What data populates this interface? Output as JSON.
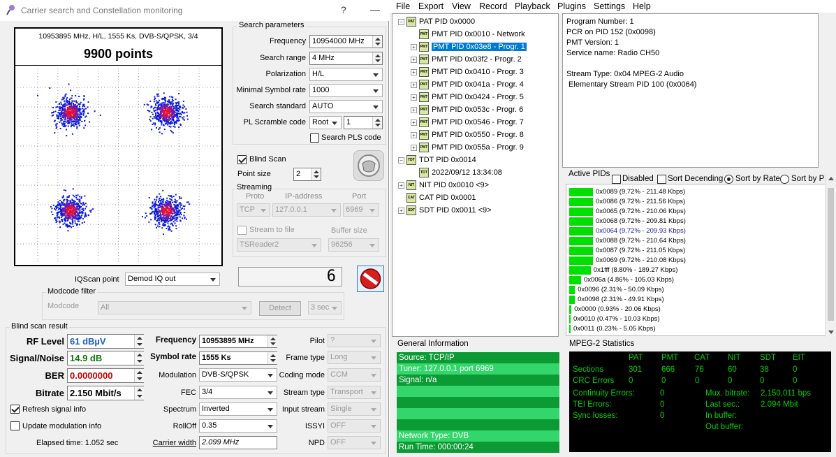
{
  "left_window": {
    "title": "Carrier search and Constellation monitoring",
    "help_btn": "?",
    "minimize_btn": "—",
    "constellation": {
      "info": "10953895 MHz, H/L, 1555 Ks, DVB-S/QPSK, 3/4",
      "points": "9900 points"
    },
    "search_params": {
      "group_title": "Search parameters",
      "frequency_label": "Frequency",
      "frequency": "10954000 MHz",
      "range_label": "Search range",
      "range": "4 MHz",
      "polarization_label": "Polarization",
      "polarization": "H/L",
      "min_sr_label": "Minimal Symbol rate",
      "min_sr": "1000",
      "standard_label": "Search standard",
      "standard": "AUTO",
      "pls_label": "PL Scramble code",
      "pls_mode": "Root",
      "pls_value": "1",
      "search_pls_label": "Search PLS code"
    },
    "blind_scan_label": "Blind Scan",
    "point_size_label": "Point size",
    "point_size": "2",
    "streaming": {
      "group_title": "Streaming",
      "proto_label": "Proto",
      "ip_label": "IP-address",
      "port_label": "Port",
      "proto": "TCP",
      "ip": "127.0.0.1",
      "port": "6969",
      "stream_to_file": "Stream to file",
      "buffer_label": "Buffer size",
      "target": "TSReader2",
      "buffer": "96256"
    },
    "iq_label": "IQScan point",
    "iq_value": "Demod IQ out",
    "counter": "6",
    "modcode": {
      "group_title": "Modcode filter",
      "label": "Modcode",
      "value": "All",
      "detect": "Detect",
      "time": "3 sec"
    },
    "result": {
      "group_title": "Blind scan result",
      "rf_label": "RF Level",
      "rf": "61 dBµV",
      "sn_label": "Signal/Noise",
      "sn": "14.9 dB",
      "ber_label": "BER",
      "ber": "0.0000000",
      "bitrate_label": "Bitrate",
      "bitrate": "2.150 Mbit/s",
      "freq_label": "Frequency",
      "freq": "10953895 MHz",
      "sr_label": "Symbol rate",
      "sr": "1555 Ks",
      "mod_label": "Modulation",
      "mod": "DVB-S/QPSK",
      "fec_label": "FEC",
      "fec": "3/4",
      "spec_label": "Spectrum",
      "spec": "Inverted",
      "rolloff_label": "RollOff",
      "rolloff": "0.35",
      "cw_label": "Carrier width",
      "cw": "2.099 MHz",
      "pilot_label": "Pilot",
      "pilot": "?",
      "frame_label": "Frame type",
      "frame": "Long",
      "coding_label": "Coding mode",
      "coding": "CCM",
      "stype_label": "Stream type",
      "stype": "Transport",
      "istream_label": "Input stream",
      "istream": "Single",
      "issyi_label": "ISSYI",
      "issyi": "OFF",
      "npd_label": "NPD",
      "npd": "OFF",
      "refresh_label": "Refresh signal info",
      "update_label": "Update modulation info",
      "elapsed": "Elapsed time: 1.052 sec"
    }
  },
  "right_window": {
    "menu": [
      "File",
      "Export",
      "View",
      "Record",
      "Playback",
      "Plugins",
      "Settings",
      "Help"
    ],
    "tree": [
      {
        "text": "PAT PID 0x0000",
        "icon": "PAT"
      },
      {
        "text": "PMT PID 0x0010 - Network",
        "icon": "PMT"
      },
      {
        "text": "PMT PID 0x03e8 - Progr. 1",
        "icon": "PMT"
      },
      {
        "text": "PMT PID 0x03f2 - Progr. 2",
        "icon": "PMT"
      },
      {
        "text": "PMT PID 0x0410 - Progr. 3",
        "icon": "PMT"
      },
      {
        "text": "PMT PID 0x041a - Progr. 4",
        "icon": "PMT"
      },
      {
        "text": "PMT PID 0x0424 - Progr. 5",
        "icon": "PMT"
      },
      {
        "text": "PMT PID 0x053c - Progr. 6",
        "icon": "PMT"
      },
      {
        "text": "PMT PID 0x0546 - Progr. 7",
        "icon": "PMT"
      },
      {
        "text": "PMT PID 0x0550 - Progr. 8",
        "icon": "PMT"
      },
      {
        "text": "PMT PID 0x055a - Progr. 9",
        "icon": "PMT"
      },
      {
        "text": "TDT PID 0x0014",
        "icon": "TDT"
      },
      {
        "text": "2022/09/12 13:34:08",
        "icon": "TDT"
      },
      {
        "text": "NIT PID 0x0010 <9>",
        "icon": "NIT"
      },
      {
        "text": "CAT PID 0x0001",
        "icon": "CAT"
      },
      {
        "text": "SDT PID 0x0011 <9>",
        "icon": "SDT"
      }
    ],
    "info_lines": [
      "Program Number: 1",
      "PCR on PID 152 (0x0098)",
      "PMT Version: 1",
      "Service name: Radio CH50",
      "",
      "Stream Type: 0x04 MPEG-2 Audio",
      " Elementary Stream PID 100 (0x0064)"
    ],
    "active_pids": {
      "title": "Active PIDs",
      "disabled": "Disabled",
      "sort_desc": "Sort Decending",
      "sort_rate": "Sort by Rate",
      "sort_pid": "Sort by PID",
      "rows": [
        {
          "text": "0x0089 (9.72% - 211.48 Kbps)",
          "pct": 9.72
        },
        {
          "text": "0x0086 (9.72% - 211.56 Kbps)",
          "pct": 9.72
        },
        {
          "text": "0x0065 (9.72% - 210.06 Kbps)",
          "pct": 9.72
        },
        {
          "text": "0x0068 (9.72% - 209.81 Kbps)",
          "pct": 9.72
        },
        {
          "text": "0x0064 (9.72% - 209.93 Kbps)",
          "pct": 9.72
        },
        {
          "text": "0x0088 (9.72% - 210.64 Kbps)",
          "pct": 9.72
        },
        {
          "text": "0x0087 (9.72% - 211.05 Kbps)",
          "pct": 9.72
        },
        {
          "text": "0x0069 (9.72% - 210.08 Kbps)",
          "pct": 9.72
        },
        {
          "text": "0x1fff (8.80% - 189.27 Kbps)",
          "pct": 8.8
        },
        {
          "text": "0x006a (4.86% - 105.03 Kbps)",
          "pct": 4.86
        },
        {
          "text": "0x0096 (2.31% - 50.09 Kbps)",
          "pct": 2.31
        },
        {
          "text": "0x0098 (2.31% - 49.91 Kbps)",
          "pct": 2.31
        },
        {
          "text": "0x0000 (0.93% - 20.06 Kbps)",
          "pct": 0.93
        },
        {
          "text": "0x0010 (0.47% - 10.03 Kbps)",
          "pct": 0.47
        },
        {
          "text": "0x0011 (0.23% - 5.05 Kbps)",
          "pct": 0.23
        }
      ]
    },
    "general": {
      "title": "General Information",
      "lines": [
        "Source: TCP/IP",
        "Tuner: 127.0.0.1 port 6969",
        "Signal: n/a",
        "",
        "",
        "",
        "",
        "Network Type: DVB",
        "Run Time: 000:00:24"
      ]
    },
    "stats": {
      "title": "MPEG-2 Statistics",
      "headers": [
        "PAT",
        "PMT",
        "CAT",
        "NIT",
        "SDT",
        "EIT"
      ],
      "sections_label": "Sections",
      "sections": [
        "301",
        "666",
        "76",
        "60",
        "38",
        "0"
      ],
      "crc_label": "CRC Errors",
      "crc": [
        "0",
        "0",
        "0",
        "0",
        "0",
        "0"
      ],
      "cont_label": "Continuity Errors:",
      "cont": "0",
      "tei_label": "TEI Errors:",
      "tei": "0",
      "sync_label": "Sync losses:",
      "sync": "0",
      "mux_label": "Mux. bitrate:",
      "mux": "2,150,011 bps",
      "last_label": "Last sec.:",
      "last": "2.094 Mbit",
      "inbuf_label": "In buffer:",
      "outbuf_label": "Out buffer:"
    }
  },
  "colors": {
    "pid_bar": "#00e000",
    "general_dark": "#0c9a34",
    "general_light": "#33d66b",
    "stats_text": "#00d000",
    "selected": "#0078d7",
    "rf_value": "#1a5fd0",
    "sn_value": "#0a7a0a",
    "ber_value": "#d00000"
  }
}
